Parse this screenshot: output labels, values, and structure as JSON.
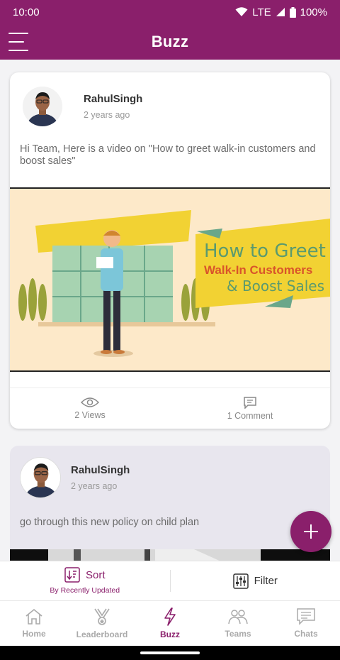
{
  "status": {
    "time": "10:00",
    "network": "LTE",
    "battery": "100%"
  },
  "app_bar": {
    "title": "Buzz"
  },
  "posts": [
    {
      "author": "RahulSingh",
      "time": "2 years ago",
      "text": "Hi Team, Here is a video on \"How to greet walk-in customers and boost sales\"",
      "media": {
        "line1": "How to Greet",
        "line2": "Walk-In Customers",
        "line3": "& Boost Sales"
      },
      "views": "2 Views",
      "comments": "1 Comment"
    },
    {
      "author": "RahulSingh",
      "time": "2 years ago",
      "text": "go through this  new policy on child plan"
    }
  ],
  "fab": {
    "icon": "plus-icon"
  },
  "sort_bar": {
    "sort_label": "Sort",
    "sort_sub": "By Recently Updated",
    "filter_label": "Filter"
  },
  "nav": [
    {
      "label": "Home",
      "icon": "home-icon"
    },
    {
      "label": "Leaderboard",
      "icon": "trophy-icon"
    },
    {
      "label": "Buzz",
      "icon": "lightning-icon"
    },
    {
      "label": "Teams",
      "icon": "team-icon"
    },
    {
      "label": "Chats",
      "icon": "chat-icon"
    }
  ],
  "colors": {
    "brand": "#8a1f6b",
    "muted": "#aaaaaa"
  }
}
